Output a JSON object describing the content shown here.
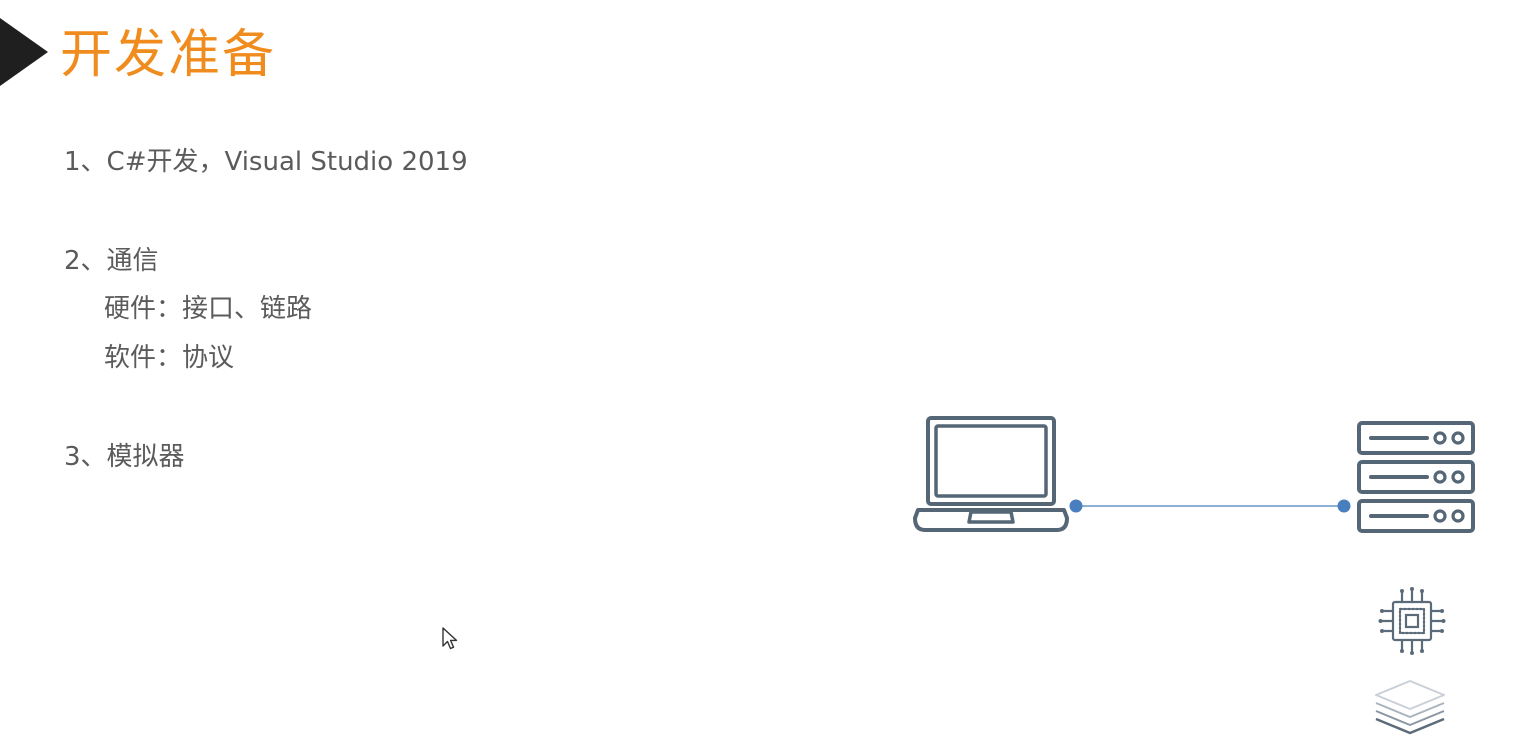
{
  "slide": {
    "title": "开发准备",
    "items": [
      "1、C#开发，Visual Studio   2019",
      "2、通信",
      "硬件：接口、链路",
      "软件：协议",
      "3、模拟器"
    ]
  },
  "diagram": {
    "icons": [
      "laptop-icon",
      "server-icon",
      "connection-line",
      "chip-icon",
      "layers-icon"
    ]
  },
  "colors": {
    "title": "#f08c1e",
    "text": "#5b5b5b",
    "icon": "#556677",
    "link_dot": "#4a7fbf",
    "link_line": "#8fb0d2"
  }
}
